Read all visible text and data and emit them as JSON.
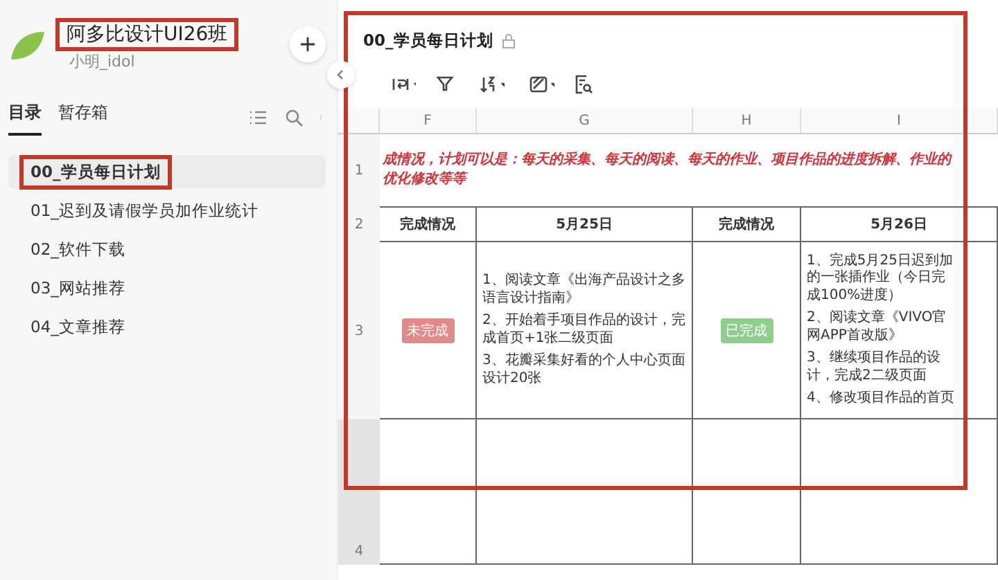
{
  "space": {
    "title": "阿多比设计UI26班",
    "subtitle": "小明_idol",
    "highlighted": true
  },
  "sidebar": {
    "tabs": [
      {
        "label": "目录",
        "selected": true
      },
      {
        "label": "暂存箱",
        "selected": false
      }
    ],
    "items": [
      {
        "label": "00_学员每日计划",
        "selected": true,
        "highlighted": true
      },
      {
        "label": "01_迟到及请假学员加作业统计",
        "selected": false,
        "highlighted": false
      },
      {
        "label": "02_软件下载",
        "selected": false,
        "highlighted": false
      },
      {
        "label": "03_网站推荐",
        "selected": false,
        "highlighted": false
      },
      {
        "label": "04_文章推荐",
        "selected": false,
        "highlighted": false
      }
    ]
  },
  "document": {
    "title": "00_学员每日计划",
    "highlighted": true,
    "columns": [
      "F",
      "G",
      "H",
      "I"
    ],
    "rows": [
      {
        "number": "1",
        "selected": false,
        "kind": "banner",
        "text": "成情况，计划可以是：每天的采集、每天的阅读、每天的作业、项目作品的进度拆解、作业的优化修改等等"
      },
      {
        "number": "2",
        "selected": false,
        "kind": "header",
        "cells": [
          "完成情况",
          "5月25日",
          "完成情况",
          "5月26日"
        ]
      },
      {
        "number": "3",
        "selected": false,
        "kind": "plan",
        "cells": [
          {
            "kind": "tag",
            "color": "#e08a8a",
            "text": "未完成"
          },
          {
            "lines": [
              "1、阅读文章《出海产品设计之多语言设计指南》",
              "2、开始着手项目作品的设计，完成首页+1张二级页面",
              "3、花瓣采集好看的个人中心页面设计20张"
            ]
          },
          {
            "kind": "tag",
            "color": "#8fce8f",
            "text": "已完成"
          },
          {
            "lines": [
              "1、完成5月25日迟到加的一张插作业（今日完成100%进度）",
              "2、阅读文章《VIVO官网APP首改版》",
              "3、继续项目作品的设计，完成2二级页面",
              "4、修改项目作品的首页"
            ]
          }
        ]
      },
      {
        "number": "4",
        "selected": true,
        "kind": "empty"
      }
    ]
  }
}
